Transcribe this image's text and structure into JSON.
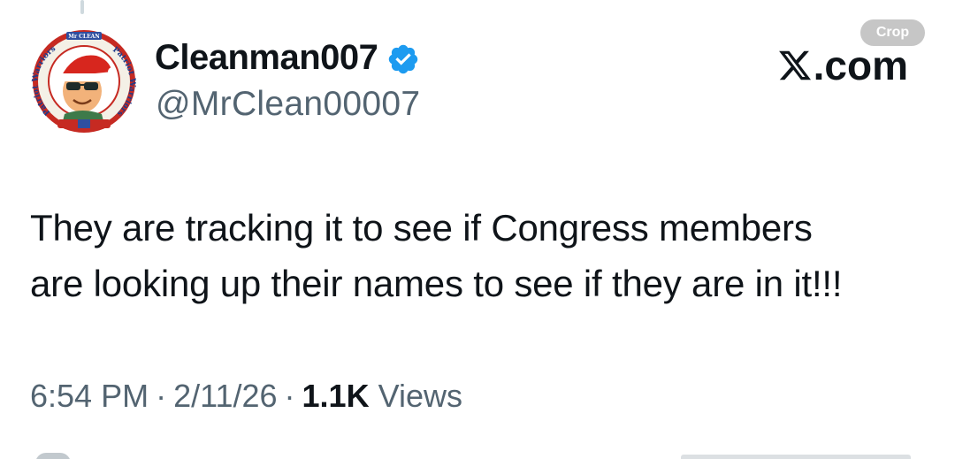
{
  "post": {
    "author": {
      "display_name": "Cleanman007",
      "handle": "@MrClean00007",
      "verified": true,
      "avatar_text": {
        "top": "Mr CLEAN",
        "left": "Patriot Warriors",
        "right": "Patriot Warriors"
      }
    },
    "text_lines": [
      "They are tracking it to see if Congress members",
      "are looking up their names to see if they are in it!!!"
    ],
    "time": "6:54 PM",
    "date": "2/11/26",
    "separator": "·",
    "views_count": "1.1K",
    "views_label": "Views"
  },
  "brand": {
    "label": ".com",
    "icon": "x-logo-icon"
  },
  "toolbar": {
    "crop_label": "Crop"
  },
  "colors": {
    "text_primary": "#0f1419",
    "text_secondary": "#536471",
    "verified": "#1d9bf0",
    "crop_badge": "#c6c6c6"
  }
}
